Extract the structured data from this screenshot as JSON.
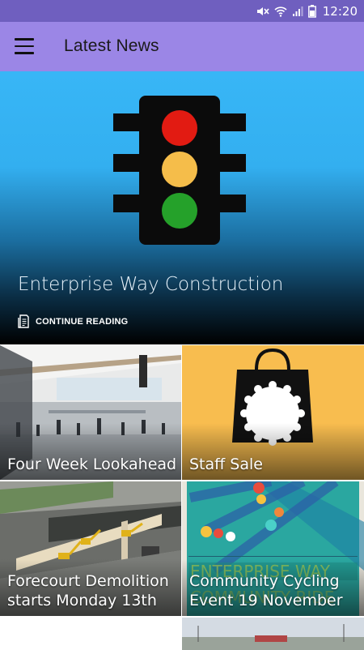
{
  "status_bar": {
    "time": "12:20",
    "icons": [
      "mute-icon",
      "wifi-icon",
      "signal-icon",
      "battery-icon"
    ]
  },
  "app_bar": {
    "title": "Latest News"
  },
  "hero": {
    "title": "Enterprise Way Construction",
    "cta": "CONTINUE READING"
  },
  "tiles": [
    {
      "title": "Four Week Lookahead"
    },
    {
      "title": "Staff Sale"
    },
    {
      "title": "Forecourt Demolition starts Monday 13th",
      "line1": "Forecourt Demolition",
      "line2": "starts Monday 13th"
    },
    {
      "title": "Community Cycling Event 19 November",
      "line1": "Community Cycling",
      "line2": "Event 19 November"
    }
  ],
  "colors": {
    "status_bar": "#6f5fbf",
    "app_bar": "#9b86e6",
    "hero_top": "#38b6f6",
    "staff_sale_bg": "#f8bd4f",
    "cycling_bg": "#2aa7a0"
  }
}
